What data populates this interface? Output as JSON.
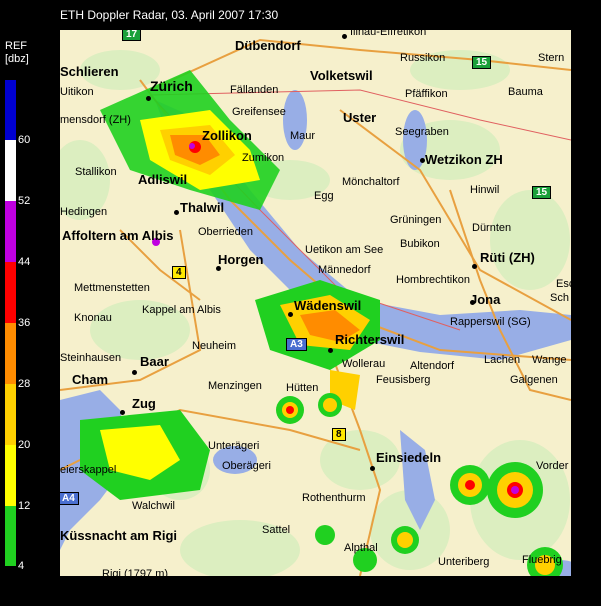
{
  "header": {
    "title": "ETH Doppler Radar, 03. April 2007 17:30"
  },
  "legend": {
    "unit_line1": "REF",
    "unit_line2": "[dbz]",
    "ticks": [
      "60",
      "52",
      "44",
      "36",
      "28",
      "20",
      "12",
      "4"
    ],
    "colors": [
      "#0000d0",
      "#ffffff",
      "#c000e0",
      "#ff0000",
      "#ff8c00",
      "#ffd000",
      "#ffff00",
      "#20d020"
    ]
  },
  "map": {
    "places": {
      "zurich": "Zürich",
      "dubendorf": "Dübendorf",
      "russikon": "Russikon",
      "volketswil": "Volketswil",
      "schlieren": "Schlieren",
      "uitikon": "Uitikon",
      "fallanden": "Fällanden",
      "greifensee": "Greifensee",
      "pfaffikon": "Pfäffikon",
      "bauma": "Bauma",
      "uster": "Uster",
      "mendorf": "mensdorf (ZH)",
      "zollikon": "Zollikon",
      "maur": "Maur",
      "seegraben": "Seegraben",
      "zumikon": "Zumikon",
      "wetzikon": "Wetzikon ZH",
      "stallikon": "Stallikon",
      "adliswil": "Adliswil",
      "monchaltorf": "Mönchaltorf",
      "hinwil": "Hinwil",
      "egg": "Egg",
      "hedingen": "Hedingen",
      "thalwil": "Thalwil",
      "gruningen": "Grüningen",
      "oberrieden": "Oberrieden",
      "durnten": "Dürnten",
      "affoltern": "Affoltern am Albis",
      "bubikon": "Bubikon",
      "uetikon": "Uetikon am See",
      "ruti": "Rüti (ZH)",
      "horgen": "Horgen",
      "mannedorf": "Männedorf",
      "hombrechtikon": "Hombrechtikon",
      "mettmenstetten": "Mettmenstetten",
      "jona": "Jona",
      "wadenswil": "Wädenswil",
      "rapperswil": "Rapperswil (SG)",
      "knonau": "Knonau",
      "kappel": "Kappel am Albis",
      "richterswil": "Richterswil",
      "neuheim": "Neuheim",
      "wollerau": "Wollerau",
      "altendorf": "Altendorf",
      "lachen": "Lachen",
      "wangen": "Wange",
      "steinhausen": "Steinhausen",
      "baar": "Baar",
      "feusisberg": "Feusisberg",
      "galgenen": "Galgenen",
      "cham": "Cham",
      "menzingen": "Menzingen",
      "hutten": "Hütten",
      "zug": "Zug",
      "unterageri": "Unterägeri",
      "oberageri": "Oberägeri",
      "einsiedeln": "Einsiedeln",
      "vorder": "Vorder",
      "steinerkappel": "eierskappel",
      "walchwil": "Walchwil",
      "rothenthurm": "Rothenthurm",
      "kussnacht": "Küssnacht am Rigi",
      "sattel": "Sattel",
      "alpthal": "Alpthal",
      "unteriberg": "Unteriberg",
      "fluebrig": "Fluebrig",
      "rigi": "Rigi (1797 m)",
      "stern": "Stern",
      "esch": "Esc",
      "schlatt": "Sch",
      "dietlikon": "Illnau-Effretikon"
    },
    "shields": {
      "r17": "17",
      "r15a": "15",
      "r15b": "15",
      "r4": "4",
      "a3": "A3",
      "r8": "8",
      "a4": "A4"
    }
  }
}
